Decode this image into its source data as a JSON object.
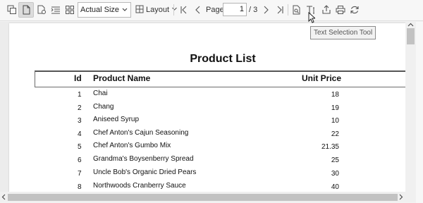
{
  "toolbar": {
    "zoom_value": "Actual Size",
    "layout_label": "Layout",
    "page_label": "Page",
    "page_current": "1",
    "page_total": "/ 3"
  },
  "tooltip": {
    "text": "Text Selection Tool"
  },
  "report": {
    "title": "Product List",
    "columns": {
      "id": "Id",
      "name": "Product Name",
      "price": "Unit Price"
    },
    "rows": [
      {
        "id": "1",
        "name": "Chai",
        "price": "18"
      },
      {
        "id": "2",
        "name": "Chang",
        "price": "19"
      },
      {
        "id": "3",
        "name": "Aniseed Syrup",
        "price": "10"
      },
      {
        "id": "4",
        "name": "Chef Anton's Cajun Seasoning",
        "price": "22"
      },
      {
        "id": "5",
        "name": "Chef Anton's Gumbo Mix",
        "price": "21.35"
      },
      {
        "id": "6",
        "name": "Grandma's Boysenberry Spread",
        "price": "25"
      },
      {
        "id": "7",
        "name": "Uncle Bob's Organic Dried Pears",
        "price": "30"
      },
      {
        "id": "8",
        "name": "Northwoods Cranberry Sauce",
        "price": "40"
      }
    ]
  },
  "icons": [
    "copy-icon",
    "single-page-icon",
    "page-settings-icon",
    "outline-icon",
    "thumbnails-icon",
    "chevron-down-icon",
    "layout-icon",
    "first-page-icon",
    "previous-page-icon",
    "next-page-icon",
    "last-page-icon",
    "find-icon",
    "text-selection-icon",
    "export-icon",
    "print-icon",
    "refresh-icon"
  ],
  "colors": {
    "toolbar_bg": "#f7f7f7",
    "viewer_bg": "#ececec",
    "paper": "#ffffff",
    "scroll_thumb": "#c2c2c2"
  }
}
